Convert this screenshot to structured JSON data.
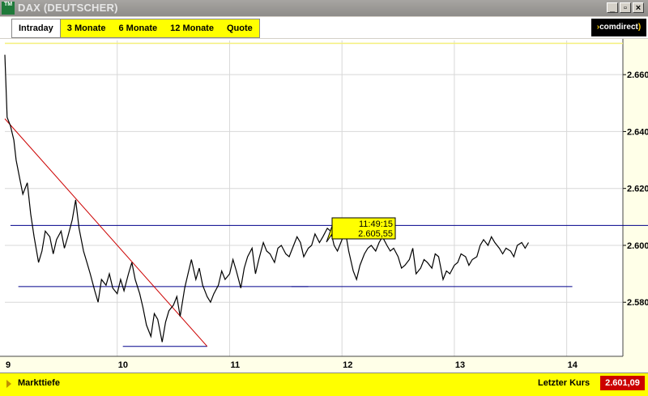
{
  "window": {
    "title": "DAX (DEUTSCHER)",
    "app_icon": "TM",
    "controls": [
      "minimize-icon",
      "restore-icon",
      "close-icon"
    ]
  },
  "tabs": [
    {
      "label": "Intraday",
      "active": true
    },
    {
      "label": "3 Monate",
      "active": false
    },
    {
      "label": "6 Monate",
      "active": false
    },
    {
      "label": "12 Monate",
      "active": false
    },
    {
      "label": "Quote",
      "active": false
    }
  ],
  "brand": {
    "label": "comdirect"
  },
  "colors": {
    "accent": "#ffff00",
    "brand_bg": "#000000",
    "last_price_bg": "#cc0000",
    "line": "#000000",
    "trend": "#cc0000",
    "level": "#00008b"
  },
  "chart_data": {
    "type": "line",
    "xlabel": "",
    "ylabel": "",
    "xlim": [
      9.0,
      14.5
    ],
    "ylim": [
      2561,
      2672
    ],
    "x_ticks": [
      "9",
      "10",
      "11",
      "12",
      "13",
      "14"
    ],
    "y_ticks": [
      "2.660",
      "2.640",
      "2.620",
      "2.600",
      "2.580"
    ],
    "grid": true,
    "series": [
      {
        "x": [
          9.0,
          9.02,
          9.05,
          9.08,
          9.1,
          9.13,
          9.16,
          9.2,
          9.23,
          9.26,
          9.3,
          9.33,
          9.36,
          9.4,
          9.43,
          9.46,
          9.5,
          9.53,
          9.56,
          9.6,
          9.63,
          9.66,
          9.7,
          9.73,
          9.76,
          9.8,
          9.83,
          9.86,
          9.9,
          9.93,
          9.96,
          10.0,
          10.03,
          10.06,
          10.1,
          10.13,
          10.16,
          10.2,
          10.23,
          10.26,
          10.3,
          10.33,
          10.36,
          10.4,
          10.43,
          10.46,
          10.5,
          10.53,
          10.56,
          10.6,
          10.63,
          10.66,
          10.7,
          10.73,
          10.76,
          10.8,
          10.83,
          10.86,
          10.9,
          10.93,
          10.96,
          11.0,
          11.03,
          11.06,
          11.1,
          11.13,
          11.16,
          11.2,
          11.23,
          11.26,
          11.3,
          11.33,
          11.36,
          11.4,
          11.43,
          11.46,
          11.5,
          11.53,
          11.56,
          11.6,
          11.63,
          11.66,
          11.7,
          11.73,
          11.76,
          11.8,
          11.83,
          11.87,
          11.9,
          11.93,
          11.96,
          12.0,
          12.03,
          12.06,
          12.1,
          12.13,
          12.16,
          12.2,
          12.23,
          12.26,
          12.3,
          12.33,
          12.36,
          12.4,
          12.43,
          12.46,
          12.5,
          12.53,
          12.56,
          12.6,
          12.63,
          12.66,
          12.7,
          12.73,
          12.76,
          12.8,
          12.83,
          12.86,
          12.9,
          12.93,
          12.96,
          13.0,
          13.03,
          13.06,
          13.1,
          13.13,
          13.16,
          13.2,
          13.23,
          13.26,
          13.3,
          13.33,
          13.36,
          13.4,
          13.43,
          13.46,
          13.5,
          13.53,
          13.56,
          13.6,
          13.63,
          13.66
        ],
        "values": [
          2667,
          2645,
          2642,
          2637,
          2630,
          2624,
          2618,
          2622,
          2611,
          2603,
          2594,
          2598,
          2605,
          2603,
          2597,
          2602,
          2605,
          2599,
          2603,
          2609,
          2616,
          2606,
          2598,
          2594,
          2590,
          2584,
          2580,
          2588,
          2586,
          2590,
          2585,
          2583,
          2588,
          2584,
          2590,
          2594,
          2588,
          2583,
          2578,
          2572,
          2568,
          2576,
          2574,
          2566,
          2573,
          2577,
          2579,
          2582,
          2575,
          2585,
          2590,
          2595,
          2588,
          2592,
          2586,
          2582,
          2580,
          2583,
          2586,
          2591,
          2588,
          2590,
          2595,
          2591,
          2585,
          2592,
          2596,
          2599,
          2590,
          2595,
          2601,
          2598,
          2597,
          2594,
          2599,
          2600,
          2597,
          2596,
          2599,
          2603,
          2601,
          2596,
          2599,
          2600,
          2604,
          2601,
          2603,
          2606,
          2605,
          2600,
          2598,
          2602,
          2605,
          2598,
          2591,
          2588,
          2593,
          2597,
          2599,
          2600,
          2598,
          2601,
          2603,
          2600,
          2598,
          2599,
          2596,
          2592,
          2593,
          2595,
          2599,
          2590,
          2592,
          2595,
          2594,
          2592,
          2597,
          2596,
          2588,
          2591,
          2590,
          2593,
          2594,
          2597,
          2596,
          2593,
          2595,
          2596,
          2600,
          2602,
          2600,
          2603,
          2601,
          2599,
          2597,
          2599,
          2598,
          2596,
          2600,
          2601,
          2599,
          2601
        ]
      }
    ],
    "annotations": {
      "trend_line": {
        "from": [
          9.0,
          2644.5
        ],
        "to": [
          10.8,
          2564.5
        ]
      },
      "levels": [
        {
          "value": 2607,
          "x_from": 9.05,
          "x_to": 14.85
        },
        {
          "value": 2585.5,
          "x_from": 9.12,
          "x_to": 11.7
        },
        {
          "value": 2585.5,
          "x_from": 11.55,
          "x_to": 14.05
        },
        {
          "value": 2564.5,
          "x_from": 10.05,
          "x_to": 10.8
        }
      ],
      "upper_line": {
        "value": 2671
      },
      "tooltip": {
        "time": "11:49:15",
        "value": "2.605,55"
      }
    }
  },
  "status": {
    "depth_label": "Markttiefe",
    "last_label": "Letzter Kurs",
    "last_value": "2.601,09"
  }
}
